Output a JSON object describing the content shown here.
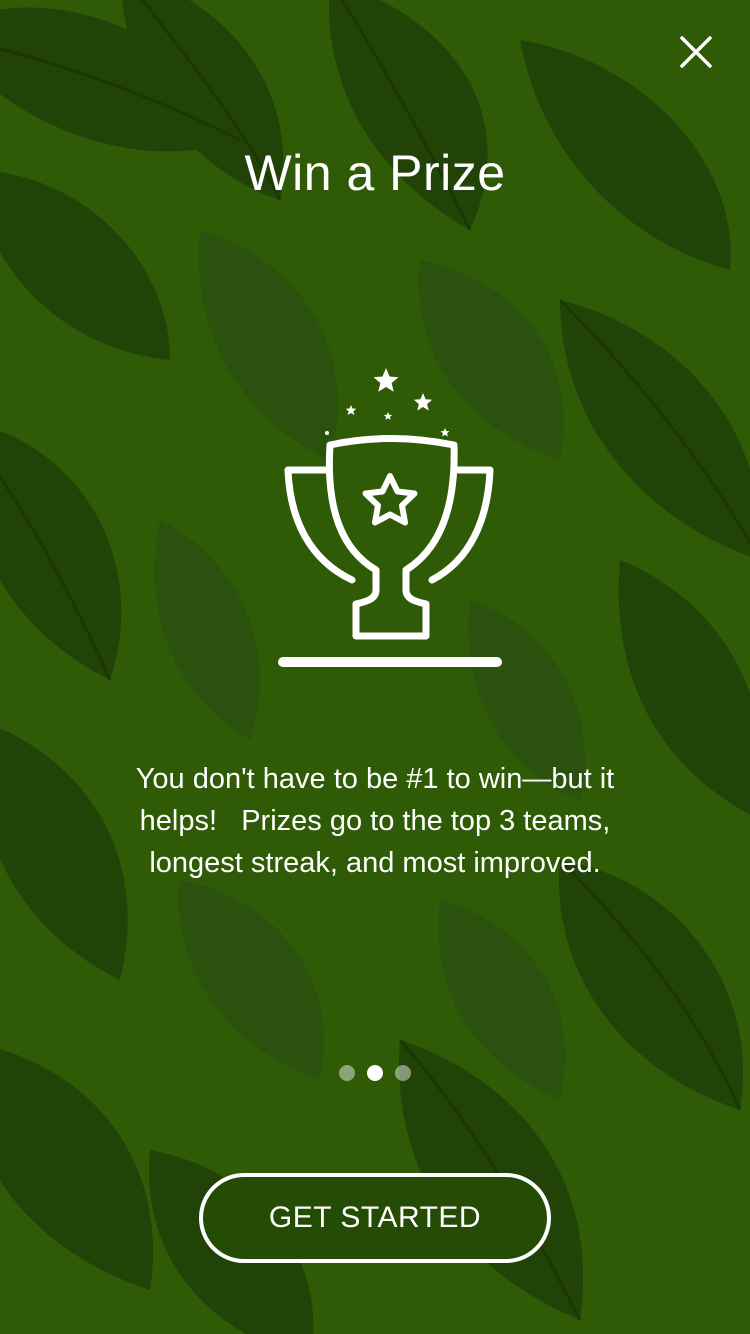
{
  "colors": {
    "background": "#2f5a06",
    "leaf_dark": "#1f4008",
    "leaf_mid": "#2a5010",
    "text": "#ffffff",
    "button_fill": "#254c05"
  },
  "close": {
    "icon": "close-icon"
  },
  "onboarding": {
    "title": "Win a Prize",
    "illustration_icon": "trophy-icon",
    "message": "You don't have to be #1 to win—but it helps!   Prizes go to the top 3 teams, longest streak, and most improved."
  },
  "pagination": {
    "total": 3,
    "active_index": 1
  },
  "cta": {
    "label": "GET STARTED"
  }
}
